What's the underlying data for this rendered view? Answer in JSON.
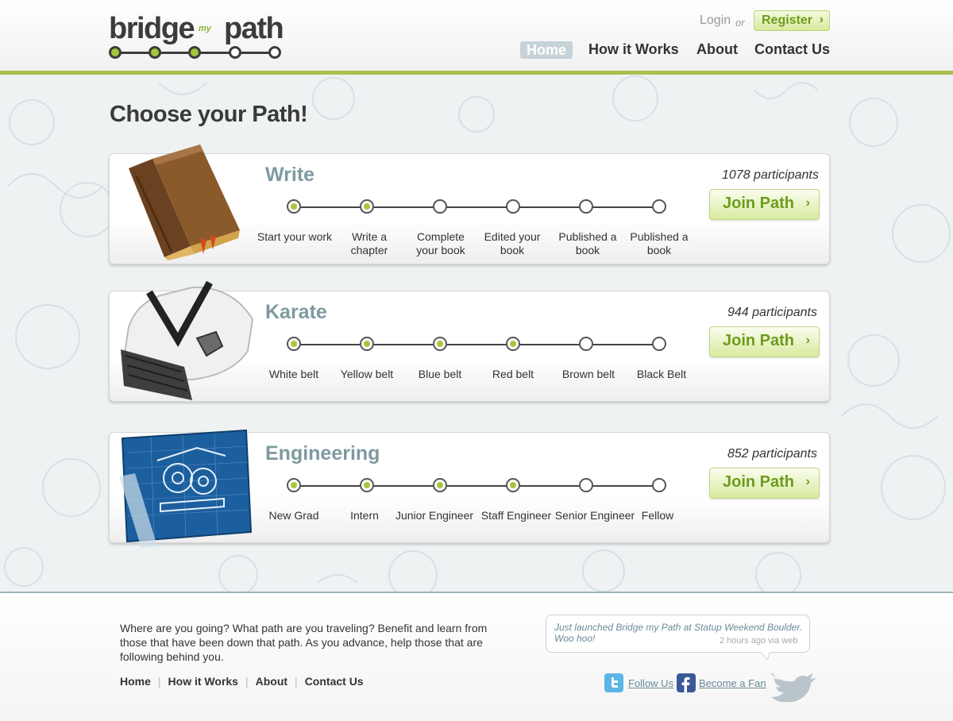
{
  "brand": {
    "logo_main": "bridge",
    "logo_end": "path",
    "logo_my": "my"
  },
  "header": {
    "login": "Login",
    "or": "or",
    "register": "Register",
    "nav": [
      "Home",
      "How it Works",
      "About",
      "Contact Us"
    ],
    "accent": "#a9c04b"
  },
  "main": {
    "title": "Choose your Path!",
    "paths": [
      {
        "title": "Write",
        "participants": "1078 participants",
        "join": "Join Path",
        "completed": 2,
        "steps": [
          "Start your work",
          "Write a chapter",
          "Complete your book",
          "Edited your book",
          "Published a book",
          "Published a book"
        ],
        "icon": "book-icon"
      },
      {
        "title": "Karate",
        "participants": "944 participants",
        "join": "Join Path",
        "completed": 4,
        "steps": [
          "White belt",
          "Yellow belt",
          "Blue belt",
          "Red belt",
          "Brown belt",
          "Black Belt"
        ],
        "icon": "karate-gi-icon"
      },
      {
        "title": "Engineering",
        "participants": "852 participants",
        "join": "Join Path",
        "completed": 4,
        "steps": [
          "New Grad",
          "Intern",
          "Junior Engineer",
          "Staff Engineer",
          "Senior Engineer",
          "Fellow"
        ],
        "icon": "blueprint-icon"
      }
    ]
  },
  "footer": {
    "description": "Where are you going?  What path are you traveling?  Benefit and learn from those that have been down that path.  As you advance, help those that are following behind you.",
    "links": [
      "Home",
      "How it Works",
      "About",
      "Contact Us"
    ],
    "tweet": {
      "text": "Just launched Bridge my Path at Statup Weekend Boulder. Woo hoo!",
      "time": "2 hours ago via web"
    },
    "follow": "Follow Us",
    "fan": "Become a Fan"
  }
}
